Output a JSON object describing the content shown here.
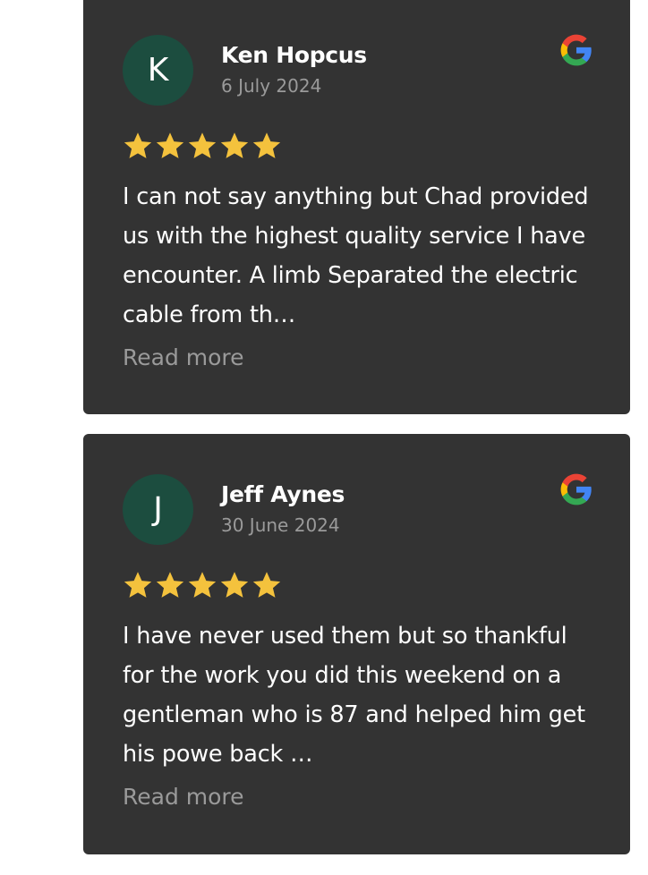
{
  "reviews": [
    {
      "avatar_initial": "K",
      "author": "Ken Hopcus",
      "date": "6 July 2024",
      "rating": 5,
      "text": "I can not say anything but Chad provided us with the highest quality service I have encounter. A limb Separated the electric cable from th…",
      "read_more_label": "Read more",
      "source_icon": "google-icon"
    },
    {
      "avatar_initial": "J",
      "author": "Jeff Aynes",
      "date": "30 June 2024",
      "rating": 5,
      "text": "I have never used them but so thankful for the work you did this weekend on a gentleman who is 87 and helped him get his powe back …",
      "read_more_label": "Read more",
      "source_icon": "google-icon"
    }
  ],
  "colors": {
    "card_background": "#333333",
    "avatar_background": "#1c4d3f",
    "star": "#f4c23d",
    "muted_text": "#9a9a9a"
  }
}
